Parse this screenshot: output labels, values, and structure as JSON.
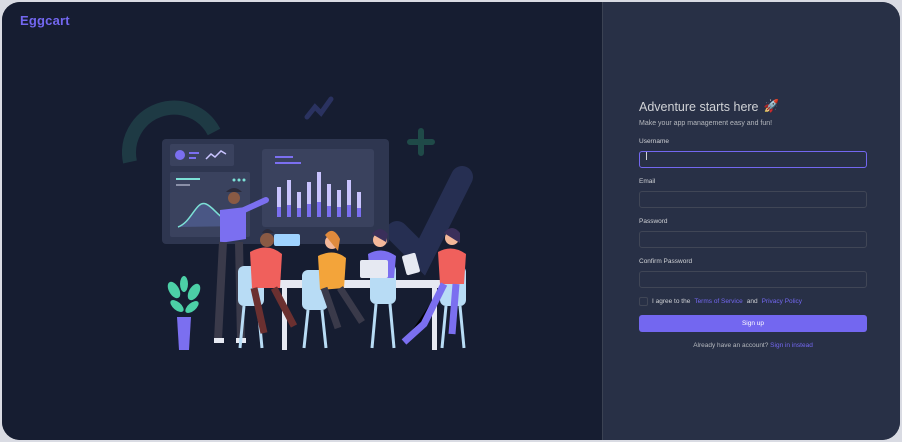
{
  "brand": {
    "name": "Eggcart",
    "color": "#7367f0"
  },
  "form": {
    "title": "Adventure starts here",
    "title_icon": "rocket-icon",
    "title_emoji": "🚀",
    "subtitle": "Make your app management easy and fun!",
    "username": {
      "label": "Username",
      "value": "",
      "placeholder": ""
    },
    "email": {
      "label": "Email",
      "value": "",
      "placeholder": ""
    },
    "password": {
      "label": "Password",
      "value": "",
      "placeholder": ""
    },
    "confirm_password": {
      "label": "Confirm Password",
      "value": "",
      "placeholder": ""
    },
    "agree": {
      "prefix": "I agree to the",
      "terms": "Terms of Service",
      "and": "and",
      "privacy": "Privacy Policy",
      "checked": false
    },
    "submit": "Sign up",
    "footer": {
      "text": "Already have an account?",
      "link": "Sign in instead"
    }
  },
  "colors": {
    "primary": "#7367f0",
    "left_bg": "#161d31",
    "right_bg": "#283046"
  }
}
